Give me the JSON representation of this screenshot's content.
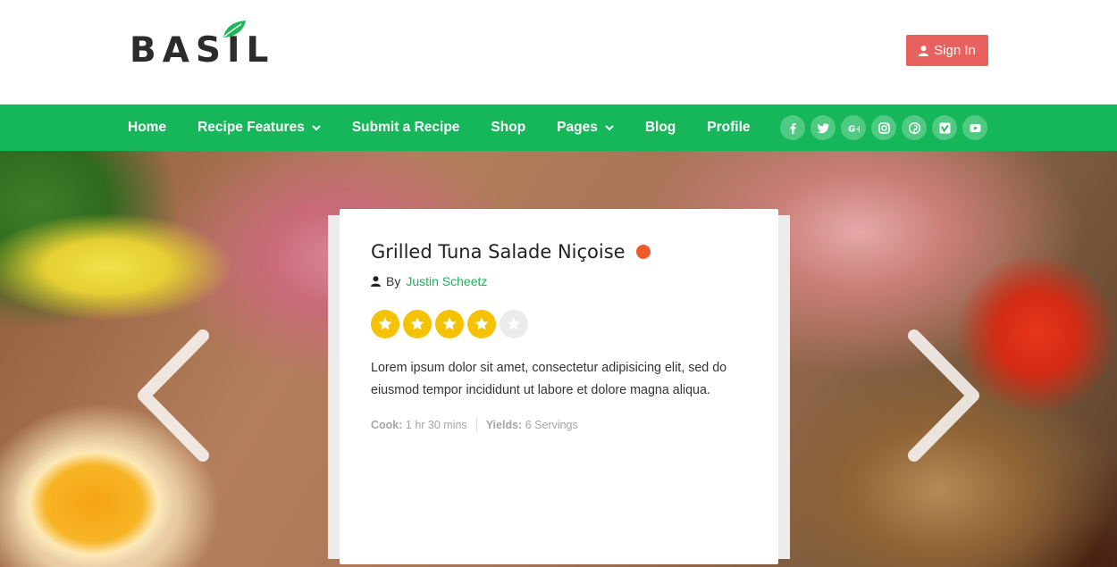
{
  "header": {
    "logo_text": "BASIL",
    "signin_label": "Sign In",
    "signin_color": "#e9615f"
  },
  "nav": {
    "background": "#16b75a",
    "items": [
      {
        "label": "Home",
        "dropdown": false
      },
      {
        "label": "Recipe Features",
        "dropdown": true
      },
      {
        "label": "Submit a Recipe",
        "dropdown": false
      },
      {
        "label": "Shop",
        "dropdown": false
      },
      {
        "label": "Pages",
        "dropdown": true
      },
      {
        "label": "Blog",
        "dropdown": false
      },
      {
        "label": "Profile",
        "dropdown": false
      }
    ],
    "socials": [
      "facebook-icon",
      "twitter-icon",
      "google-plus-icon",
      "instagram-icon",
      "pinterest-icon",
      "vimeo-icon",
      "youtube-icon"
    ]
  },
  "recipe": {
    "title": "Grilled Tuna Salade Niçoise",
    "status_dot_color": "#ee5a2a",
    "by_label": "By",
    "author": "Justin Scheetz",
    "rating": 4,
    "rating_max": 5,
    "description": "Lorem ipsum dolor sit amet, consectetur adipisicing elit, sed do eiusmod tempor incididunt ut labore et dolore magna aliqua.",
    "cook_label": "Cook:",
    "cook_value": "1 hr 30 mins",
    "yields_label": "Yields:",
    "yields_value": "6 Servings"
  }
}
